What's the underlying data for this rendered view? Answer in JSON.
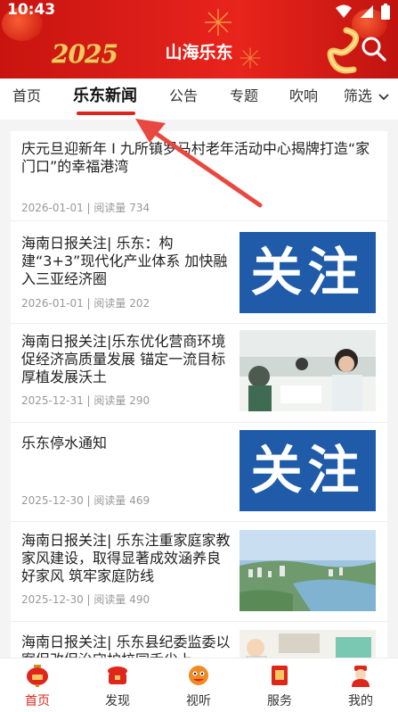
{
  "status_bar": {
    "time": "10:43"
  },
  "header": {
    "title": "山海乐东",
    "year_art": "2025"
  },
  "tabs": {
    "items": [
      {
        "label": "首页"
      },
      {
        "label": "乐东新闻"
      },
      {
        "label": "公告"
      },
      {
        "label": "专题"
      },
      {
        "label": "吹响"
      }
    ],
    "active_index": 1,
    "filter_label": "筛选"
  },
  "articles": [
    {
      "title": "庆元旦迎新年 I 九所镇罗马村老年活动中心揭牌打造“家门口”的幸福港湾",
      "meta": "2026-01-01 | 阅读量 734",
      "thumb": "none"
    },
    {
      "title": "海南日报关注| 乐东：构建“3+3”现代化产业体系 加快融入三亚经济圈",
      "meta": "2026-01-01 | 阅读量 202",
      "thumb": "guanzhu",
      "thumb_text": "关注"
    },
    {
      "title": "海南日报关注|乐东优化营商环境 促经济高质量发展 锚定一流目标 厚植发展沃土",
      "meta": "2025-12-31 | 阅读量 290",
      "thumb": "photo-office"
    },
    {
      "title": "乐东停水通知",
      "meta": "2025-12-30 | 阅读量 469",
      "thumb": "guanzhu",
      "thumb_text": "关注"
    },
    {
      "title": "海南日报关注| 乐东注重家庭家教家风建设，取得显著成效涵养良好家风 筑牢家庭防线",
      "meta": "2025-12-30 | 阅读量 490",
      "thumb": "photo-aerial"
    },
    {
      "title": "海南日报关注| 乐东县纪委监委以案促改促治守护校园舌尖上",
      "meta": "",
      "thumb": "photo-cartoon"
    }
  ],
  "bottom_nav": {
    "items": [
      {
        "label": "首页",
        "active": true
      },
      {
        "label": "发现",
        "active": false
      },
      {
        "label": "视听",
        "active": false
      },
      {
        "label": "服务",
        "active": false
      },
      {
        "label": "我的",
        "active": false
      }
    ]
  },
  "colors": {
    "brand_red": "#e0251b",
    "header_red": "#d91b15",
    "guanzhu_blue": "#1f5ba8"
  }
}
